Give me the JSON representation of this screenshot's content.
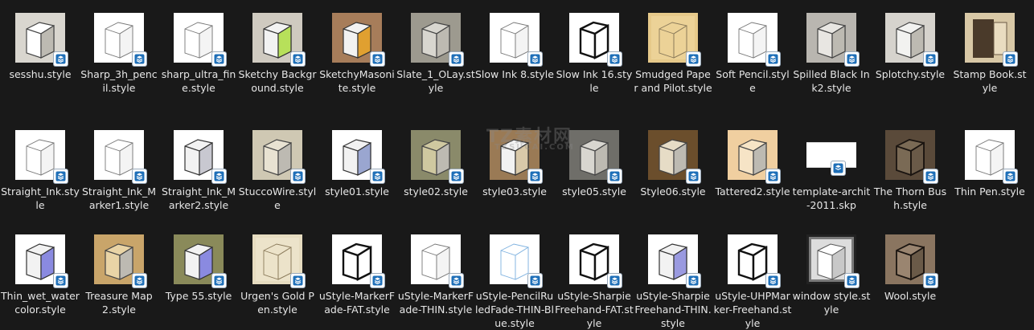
{
  "files": [
    {
      "name": "sesshu.style",
      "thumb": "cube-paper",
      "bg": "#d9d6cf",
      "fill": "#ffffff"
    },
    {
      "name": "Sharp_3h_pencil.style",
      "thumb": "cube-line",
      "bg": "#ffffff",
      "fill": "#ffffff"
    },
    {
      "name": "sharp_ultra_fine.style",
      "thumb": "cube-line",
      "bg": "#ffffff",
      "fill": "#ffffff"
    },
    {
      "name": "Sketchy Background.style",
      "thumb": "cube-color",
      "bg": "#cfcac0",
      "fill": "#b7e05a"
    },
    {
      "name": "SketchyMasonite.style",
      "thumb": "cube-color",
      "bg": "#a77d5a",
      "fill": "#e0a030"
    },
    {
      "name": "Slate_1_OLay.style",
      "thumb": "cube-paper",
      "bg": "#9d9a8f",
      "fill": "#d8d6cf"
    },
    {
      "name": "Slow Ink 8.style",
      "thumb": "cube-line",
      "bg": "#ffffff",
      "fill": "#ffffff"
    },
    {
      "name": "Slow Ink 16.style",
      "thumb": "cube-bold",
      "bg": "#ffffff",
      "fill": "#ffffff"
    },
    {
      "name": "Smudged Paper and Pilot.style",
      "thumb": "paper",
      "bg": "#e6c98a",
      "fill": "#f0d9a0"
    },
    {
      "name": "Soft Pencil.style",
      "thumb": "cube-line",
      "bg": "#ffffff",
      "fill": "#ffffff"
    },
    {
      "name": "Spilled Black Ink2.style",
      "thumb": "cube-paper",
      "bg": "#b9b6b0",
      "fill": "#e8e6e2"
    },
    {
      "name": "Splotchy.style",
      "thumb": "cube-paper",
      "bg": "#d6d3cd",
      "fill": "#f2f2f0"
    },
    {
      "name": "Stamp Book.style",
      "thumb": "book",
      "bg": "#d8c8a6",
      "fill": "#4a3a2a"
    },
    {
      "name": "Straight_Ink.style",
      "thumb": "cube-line",
      "bg": "#ffffff",
      "fill": "#ffffff"
    },
    {
      "name": "Straight_Ink_Marker1.style",
      "thumb": "cube-line",
      "bg": "#ffffff",
      "fill": "#ffffff"
    },
    {
      "name": "Straight_Ink_Marker2.style",
      "thumb": "cube-color",
      "bg": "#ffffff",
      "fill": "#c8c8d0"
    },
    {
      "name": "StuccoWire.style",
      "thumb": "cube-paper",
      "bg": "#cfc8b3",
      "fill": "#e8e2d2"
    },
    {
      "name": "style01.style",
      "thumb": "cube-color",
      "bg": "#ffffff",
      "fill": "#9aa6d0"
    },
    {
      "name": "style02.style",
      "thumb": "cube-paper",
      "bg": "#8a8a6a",
      "fill": "#cfc8a0"
    },
    {
      "name": "style03.style",
      "thumb": "cube-color",
      "bg": "#9a7a55",
      "fill": "#d9c9a9"
    },
    {
      "name": "style05.style",
      "thumb": "cube-paper",
      "bg": "#6f6e69",
      "fill": "#d8d6d0"
    },
    {
      "name": "Style06.style",
      "thumb": "cube-paper",
      "bg": "#6b4e2c",
      "fill": "#e6dcc6"
    },
    {
      "name": "Tattered2.style",
      "thumb": "cube-paper",
      "bg": "#f0cfa0",
      "fill": "#f6e4c6"
    },
    {
      "name": "template-archit-2011.skp",
      "thumb": "blank",
      "bg": "#ffffff",
      "fill": "#ffffff"
    },
    {
      "name": "The Thorn Bush.style",
      "thumb": "cube-dark",
      "bg": "#5a4a3a",
      "fill": "#7a6a55"
    },
    {
      "name": "Thin Pen.style",
      "thumb": "cube-line",
      "bg": "#ffffff",
      "fill": "#ffffff"
    },
    {
      "name": "Thin_wet_watercolor.style",
      "thumb": "cube-color",
      "bg": "#ffffff",
      "fill": "#8a8ae0"
    },
    {
      "name": "Treasure Map 2.style",
      "thumb": "cube-paper",
      "bg": "#c9a56a",
      "fill": "#e9d4a6"
    },
    {
      "name": "Type 55.style",
      "thumb": "cube-color",
      "bg": "#8a8a5a",
      "fill": "#8a8ae0"
    },
    {
      "name": "Urgen's Gold Pen.style",
      "thumb": "paper",
      "bg": "#e6dcc0",
      "fill": "#f0e8d0"
    },
    {
      "name": "uStyle-MarkerFade-FAT.style",
      "thumb": "cube-bold",
      "bg": "#ffffff",
      "fill": "#ffffff"
    },
    {
      "name": "uStyle-MarkerFade-THIN.style",
      "thumb": "cube-line",
      "bg": "#ffffff",
      "fill": "#ffffff"
    },
    {
      "name": "uStyle-PencilRuledFade-THIN-Blue.style",
      "thumb": "cube-blue",
      "bg": "#ffffff",
      "fill": "#ffffff"
    },
    {
      "name": "uStyle-SharpieFreehand-FAT.style",
      "thumb": "cube-bold",
      "bg": "#ffffff",
      "fill": "#ffffff"
    },
    {
      "name": "uStyle-SharpieFreehand-THIN.style",
      "thumb": "cube-color",
      "bg": "#ffffff",
      "fill": "#9a9ae0"
    },
    {
      "name": "uStyle-UHPMarker-Freehand.style",
      "thumb": "cube-bold",
      "bg": "#ffffff",
      "fill": "#ffffff"
    },
    {
      "name": "window style.style",
      "thumb": "window",
      "bg": "#7a7a7a",
      "fill": "#dddddd"
    },
    {
      "name": "Wool.style",
      "thumb": "cube-dark",
      "bg": "#8a7560",
      "fill": "#9a8570"
    }
  ],
  "badge_icon": "sketchup-icon",
  "watermark": {
    "line1": "TZ素材网",
    "line2": "TZSUCAI.COM"
  }
}
